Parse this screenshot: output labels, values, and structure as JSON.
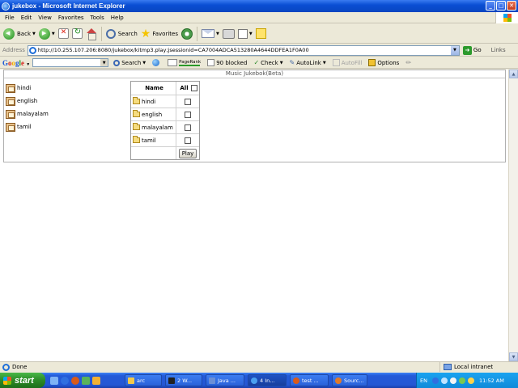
{
  "window": {
    "title": "jukebox - Microsoft Internet Explorer",
    "min_glyph": "_",
    "max_glyph": "□",
    "close_glyph": "✕"
  },
  "menu": [
    "File",
    "Edit",
    "View",
    "Favorites",
    "Tools",
    "Help"
  ],
  "toolbar": {
    "back_label": "Back",
    "search_label": "Search",
    "favorites_label": "Favorites"
  },
  "address": {
    "label": "Address",
    "url": "http://10.255.107.206:8080/jukebox/kitmp3.play;jsessionid=CA7004ADCA513280A4644DDFEA1F0A00",
    "go_label": "Go",
    "links_label": "Links"
  },
  "google_toolbar": {
    "logo_letters": [
      "G",
      "o",
      "o",
      "g",
      "l",
      "e"
    ],
    "search_label": "Search",
    "pagerank_label": "PageRank",
    "blocked_label": "90 blocked",
    "check_label": "Check",
    "autolink_label": "AutoLink",
    "autofill_label": "AutoFill",
    "options_label": "Options"
  },
  "page": {
    "header": "Music Jukebok(Beta)",
    "left_folders": [
      "hindi",
      "english",
      "malayalam",
      "tamil"
    ],
    "table": {
      "name_header": "Name",
      "all_header": "All",
      "rows": [
        "hindi",
        "english",
        "malayalam",
        "tamil"
      ],
      "play_label": "Play"
    }
  },
  "status": {
    "text": "Done",
    "zone": "Local intranet"
  },
  "taskbar": {
    "start_label": "start",
    "tasks": [
      "arc",
      "2 W...",
      "Java ...",
      "4 In...",
      "test ...",
      "Sourc..."
    ],
    "lang": "EN",
    "clock": "11:52 AM"
  }
}
